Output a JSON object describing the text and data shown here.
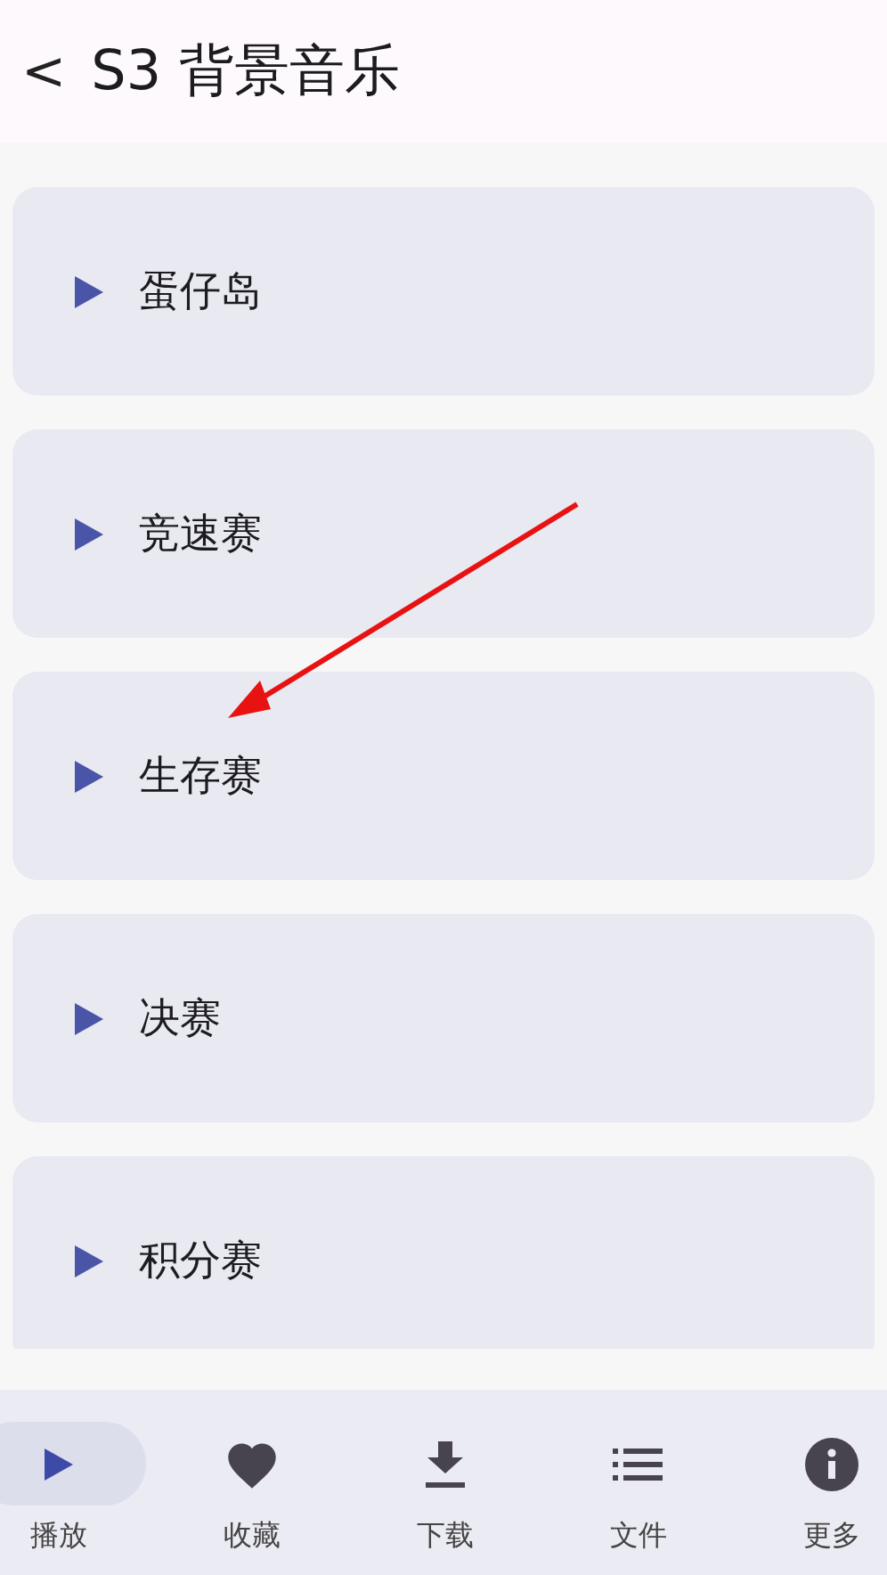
{
  "header": {
    "back": "<",
    "title": "S3 背景音乐"
  },
  "tracks": [
    {
      "name": "蛋仔岛"
    },
    {
      "name": "竞速赛"
    },
    {
      "name": "生存赛"
    },
    {
      "name": "决赛"
    },
    {
      "name": "积分赛"
    }
  ],
  "nav": [
    {
      "kind": "play",
      "label": "播放",
      "selected": true
    },
    {
      "kind": "heart",
      "label": "收藏",
      "selected": false
    },
    {
      "kind": "download",
      "label": "下载",
      "selected": false
    },
    {
      "kind": "list",
      "label": "文件",
      "selected": false
    },
    {
      "kind": "info",
      "label": "更多",
      "selected": false
    }
  ]
}
